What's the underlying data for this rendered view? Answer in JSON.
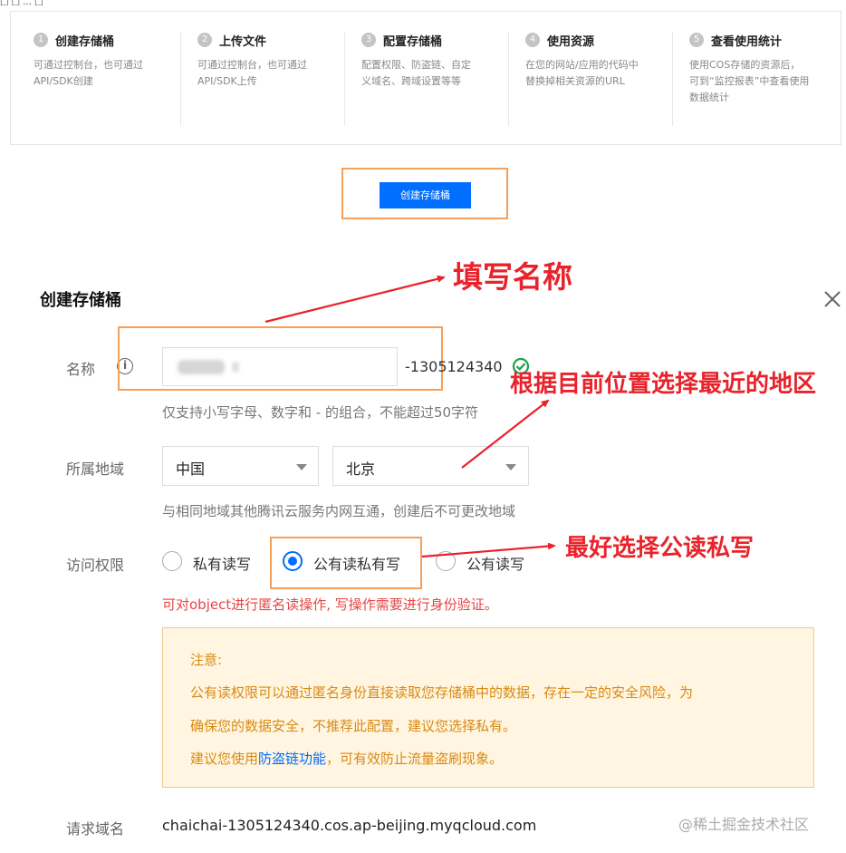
{
  "crop_text": "□ □ ... □",
  "steps": [
    {
      "num": "1",
      "title": "创建存储桶",
      "desc1": "可通过控制台，也可通过",
      "desc2": "API/SDK创建",
      "desc3": ""
    },
    {
      "num": "2",
      "title": "上传文件",
      "desc1": "可通过控制台，也可通过",
      "desc2": "API/SDK上传",
      "desc3": ""
    },
    {
      "num": "3",
      "title": "配置存储桶",
      "desc1": "配置权限、防盗链、自定",
      "desc2": "义域名、跨域设置等等",
      "desc3": ""
    },
    {
      "num": "4",
      "title": "使用资源",
      "desc1": "在您的网站/应用的代码中",
      "desc2": "替换掉相关资源的URL",
      "desc3": ""
    },
    {
      "num": "5",
      "title": "查看使用统计",
      "desc1": "使用COS存储的资源后，",
      "desc2": "可到“监控报表”中查看使用",
      "desc3": "数据统计"
    }
  ],
  "create_button": "创建存储桶",
  "dialog": {
    "title": "创建存储桶",
    "name_label": "名称",
    "name_value": "",
    "appid_suffix": "-1305124340",
    "name_hint": "仅支持小写字母、数字和 - 的组合，不能超过50字符",
    "region_label": "所属地域",
    "region_country": "中国",
    "region_city": "北京",
    "region_hint": "与相同地域其他腾讯云服务内网互通，创建后不可更改地域",
    "access_label": "访问权限",
    "access_options": [
      "私有读写",
      "公有读私有写",
      "公有读写"
    ],
    "access_selected": "公有读私有写",
    "access_note": "可对object进行匿名读操作, 写操作需要进行身份验证。",
    "warning": {
      "title": "注意:",
      "line1": "公有读权限可以通过匿名身份直接读取您存储桶中的数据，存在一定的安全风险，为",
      "line2": "确保您的数据安全，不推荐此配置，建议您选择私有。",
      "line3_pre": "建议您使用",
      "line3_link": "防盗链功能",
      "line3_post": "，可有效防止流量盗刷现象。"
    },
    "domain_label": "请求域名",
    "domain_value": "chaichai-1305124340.cos.ap-beijing.myqcloud.com"
  },
  "annotations": {
    "name": "填写名称",
    "region": "根据目前位置选择最近的地区",
    "access": "最好选择公读私写"
  },
  "watermark": "@稀土掘金技术社区",
  "colors": {
    "primary": "#006eff",
    "highlight_box": "#f5a05a",
    "annotation": "#e8232b",
    "success": "#1aa34a",
    "warning_text": "#d98a13"
  }
}
